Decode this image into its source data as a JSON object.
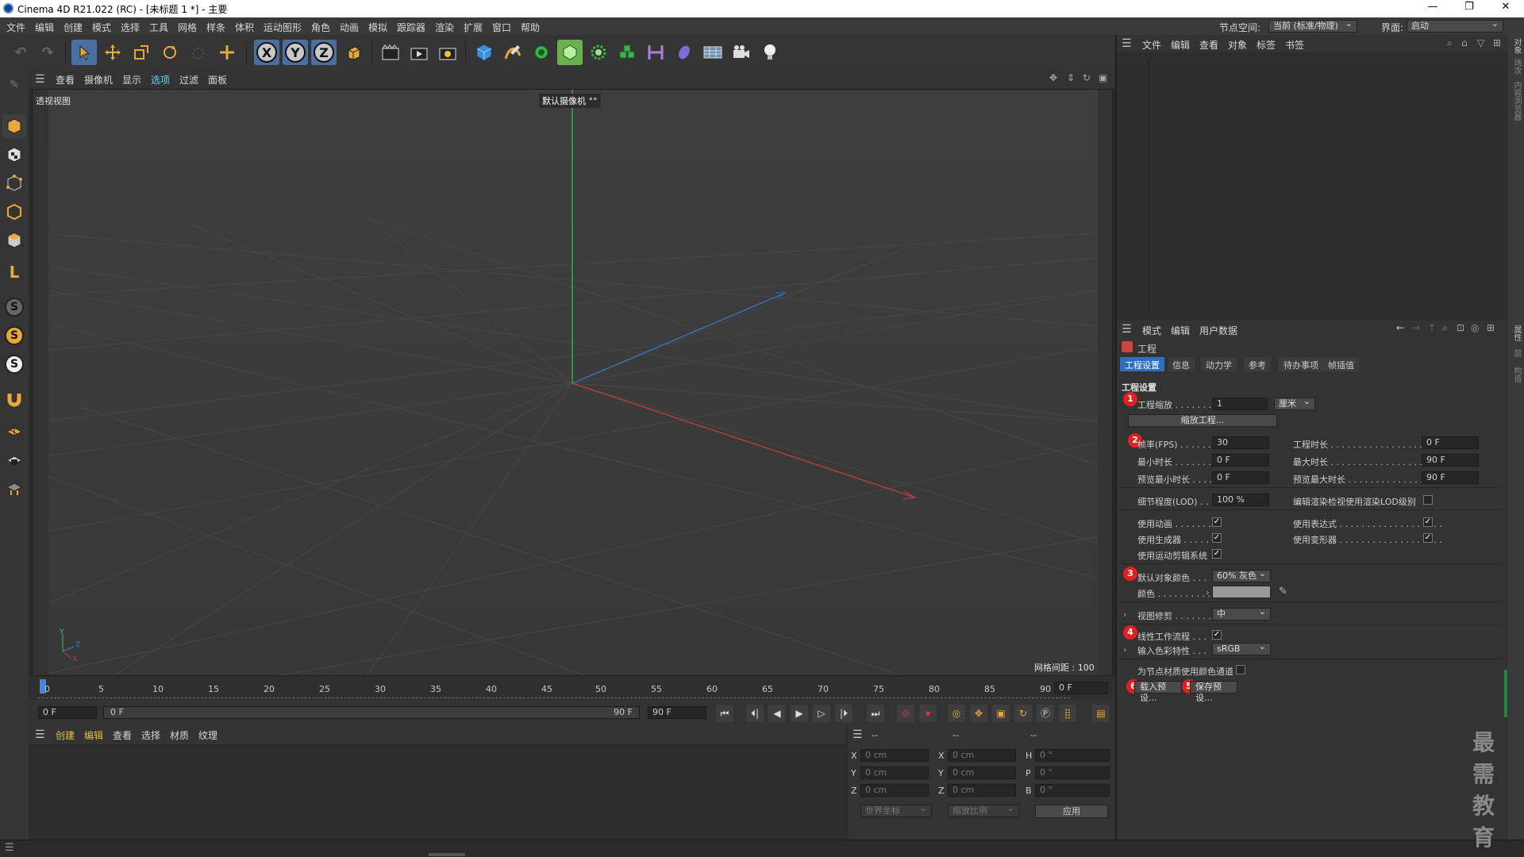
{
  "titlebar": {
    "title": "Cinema 4D R21.022 (RC) - [未标题 1 *] - 主要",
    "minimize": "—",
    "maximize": "❐",
    "close": "✕"
  },
  "menu": [
    "文件",
    "编辑",
    "创建",
    "模式",
    "选择",
    "工具",
    "网格",
    "样条",
    "体积",
    "运动图形",
    "角色",
    "动画",
    "模拟",
    "跟踪器",
    "渲染",
    "扩展",
    "窗口",
    "帮助"
  ],
  "node_space": {
    "label": "节点空间:",
    "value": "当前 (标准/物理)"
  },
  "interface": {
    "label": "界面:",
    "value": "启动"
  },
  "toolbar": {
    "x_label": "X",
    "y_label": "Y",
    "z_label": "Z"
  },
  "viewport_menu": [
    "查看",
    "摄像机",
    "显示",
    "选项",
    "过滤",
    "面板"
  ],
  "viewport": {
    "name": "透视视图",
    "camera": "默认摄像机 °°",
    "grid_spacing": "网格间距 : 100 cm"
  },
  "timeline": {
    "ticks": [
      "0",
      "5",
      "10",
      "15",
      "20",
      "25",
      "30",
      "35",
      "40",
      "45",
      "50",
      "55",
      "60",
      "65",
      "70",
      "75",
      "80",
      "85",
      "90"
    ],
    "current_frame": "0 F"
  },
  "transport": {
    "start": "0 F",
    "slider_start": "0 F",
    "slider_end": "90 F",
    "end": "90 F"
  },
  "material_menu": [
    "创建",
    "编辑",
    "查看",
    "选择",
    "材质",
    "纹理"
  ],
  "coords": {
    "rows": [
      {
        "a": "X",
        "av": "0 cm",
        "b": "X",
        "bv": "0 cm",
        "c": "H",
        "cv": "0 °"
      },
      {
        "a": "Y",
        "av": "0 cm",
        "b": "Y",
        "bv": "0 cm",
        "c": "P",
        "cv": "0 °"
      },
      {
        "a": "Z",
        "av": "0 cm",
        "b": "Z",
        "bv": "0 cm",
        "c": "B",
        "cv": "0 °"
      }
    ],
    "header1": "--",
    "header2": "--",
    "header3": "--",
    "world": "世界坐标",
    "scale": "缩放比例",
    "apply": "应用"
  },
  "object_menu": [
    "文件",
    "编辑",
    "查看",
    "对象",
    "标签",
    "书签"
  ],
  "attr_menu": [
    "模式",
    "编辑",
    "用户数据"
  ],
  "attr": {
    "object_name": "工程",
    "tabs": [
      "工程设置",
      "信息",
      "动力学",
      "参考",
      "待办事项",
      "帧插值"
    ],
    "section": "工程设置",
    "scale_label": "工程缩放 . . . . . . .",
    "scale_value": "1",
    "scale_unit": "厘米",
    "scale_button": "缩放工程...",
    "fps_label": "帧率(FPS) . . . . . .",
    "fps_value": "30",
    "min_time_label": "最小时长 . . . . . . .",
    "min_time_value": "0 F",
    "preview_min_label": "预览最小时长 . . . .",
    "preview_min_value": "0 F",
    "project_time_label": "工程时长 . . . . . . . . . . . . . . . . . . . . .",
    "project_time_value": "0 F",
    "max_time_label": "最大时长 . . . . . . . . . . . . . . . . . . . . .",
    "max_time_value": "90 F",
    "preview_max_label": "预览最大时长 . . . . . . . . . . . . . . . . . .",
    "preview_max_value": "90 F",
    "lod_label": "细节程度(LOD) . . .",
    "lod_value": "100 %",
    "render_lod_label": "编辑渲染检视使用渲染LOD级别",
    "use_anim_label": "使用动画 . . . . . . .",
    "use_gen_label": "使用生成器 . . . . .",
    "use_motion_label": "使用运动剪辑系统",
    "use_expr_label": "使用表达式 . . . . . . . . . . . . . . . . . . .",
    "use_deform_label": "使用变形器 . . . . . . . . . . . . . . . . . . .",
    "default_color_label": "默认对象颜色 . . .",
    "default_color_value": "60% 灰色",
    "color_label": "颜色 . . . . . . . . . .",
    "view_clip_label": "视图修剪 . . . . . . .",
    "view_clip_value": "中",
    "linear_label": "线性工作流程 . . .",
    "input_color_label": "输入色彩特性 . . .",
    "input_color_value": "sRGB",
    "node_color_label": "为节点材质使用颜色通道",
    "load_preset": "载入预设...",
    "save_preset": "保存预设...",
    "badges": [
      "1",
      "2",
      "3",
      "4",
      "5",
      "6"
    ]
  },
  "right_strip": [
    "对象",
    "场次",
    "内容浏览器",
    "属性",
    "层",
    "构造"
  ],
  "watermark": "最需教育",
  "colors": {
    "accent": "#2e6fc0",
    "x_axis": "#d43a3a",
    "y_axis": "#3fbf5a",
    "z_axis": "#3a78d4",
    "badge": "#e12020"
  }
}
